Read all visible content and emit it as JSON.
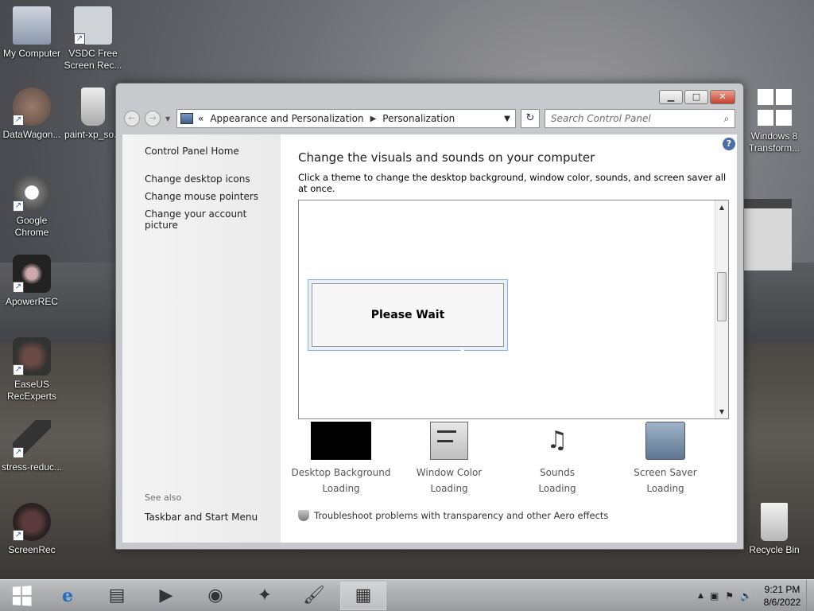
{
  "desktop": {
    "icons": [
      {
        "label": "My Computer",
        "glyph": "🖥"
      },
      {
        "label": "VSDC Free Screen Rec...",
        "glyph": "⏺"
      },
      {
        "label": "DataWagon...",
        "glyph": "✳"
      },
      {
        "label": "paint-xp_so...",
        "glyph": "🖌"
      },
      {
        "label": "Google Chrome",
        "glyph": "◉"
      },
      {
        "label": "ApowerREC",
        "glyph": "◎"
      },
      {
        "label": "EaseUS RecExperts",
        "glyph": "◍"
      },
      {
        "label": "stress-reduc...",
        "glyph": "✦"
      },
      {
        "label": "ScreenRec",
        "glyph": "●"
      },
      {
        "label": "Windows 8 Transform...",
        "glyph": "⊞"
      },
      {
        "label": "Recycle Bin",
        "glyph": "🗑"
      }
    ]
  },
  "window": {
    "controls": {
      "minimize": "▁",
      "maximize": "□",
      "close": "✕"
    },
    "nav": {
      "back": "←",
      "forward": "→",
      "history": "▼"
    },
    "address": {
      "prefix": "«",
      "crumbs": [
        "Appearance and Personalization",
        "Personalization"
      ],
      "separator": "▶",
      "dropdown": "▼"
    },
    "refresh": "↻",
    "search": {
      "placeholder": "Search Control Panel",
      "icon": "⌕"
    },
    "left": {
      "home": "Control Panel Home",
      "tasks": [
        "Change desktop icons",
        "Change mouse pointers",
        "Change your account picture"
      ],
      "see_also_label": "See also",
      "see_also_link": "Taskbar and Start Menu"
    },
    "main": {
      "help": "?",
      "title": "Change the visuals and sounds on your computer",
      "subtitle": "Click a theme to change the desktop background, window color, sounds, and screen saver all at once.",
      "wait_text": "Please Wait",
      "scroll_up": "▲",
      "scroll_down": "▼",
      "items": [
        {
          "label": "Desktop Background",
          "status": "Loading"
        },
        {
          "label": "Window Color",
          "status": "Loading"
        },
        {
          "label": "Sounds",
          "status": "Loading"
        },
        {
          "label": "Screen Saver",
          "status": "Loading"
        }
      ],
      "troubleshoot": "Troubleshoot problems with transparency and other Aero effects"
    }
  },
  "taskbar": {
    "apps": [
      {
        "name": "internet-explorer",
        "glyph": "e",
        "active": false
      },
      {
        "name": "file-explorer",
        "glyph": "▤",
        "active": false
      },
      {
        "name": "media-player",
        "glyph": "▶",
        "active": false
      },
      {
        "name": "chrome",
        "glyph": "◉",
        "active": false
      },
      {
        "name": "stress-reducer",
        "glyph": "✦",
        "active": false
      },
      {
        "name": "paint",
        "glyph": "🖌",
        "active": false
      },
      {
        "name": "control-panel",
        "glyph": "▦",
        "active": true
      }
    ],
    "tray": {
      "chevron": "▲",
      "network": "▣",
      "flag": "⚑",
      "volume": "🔊"
    },
    "time": "9:21 PM",
    "date": "8/6/2022"
  }
}
